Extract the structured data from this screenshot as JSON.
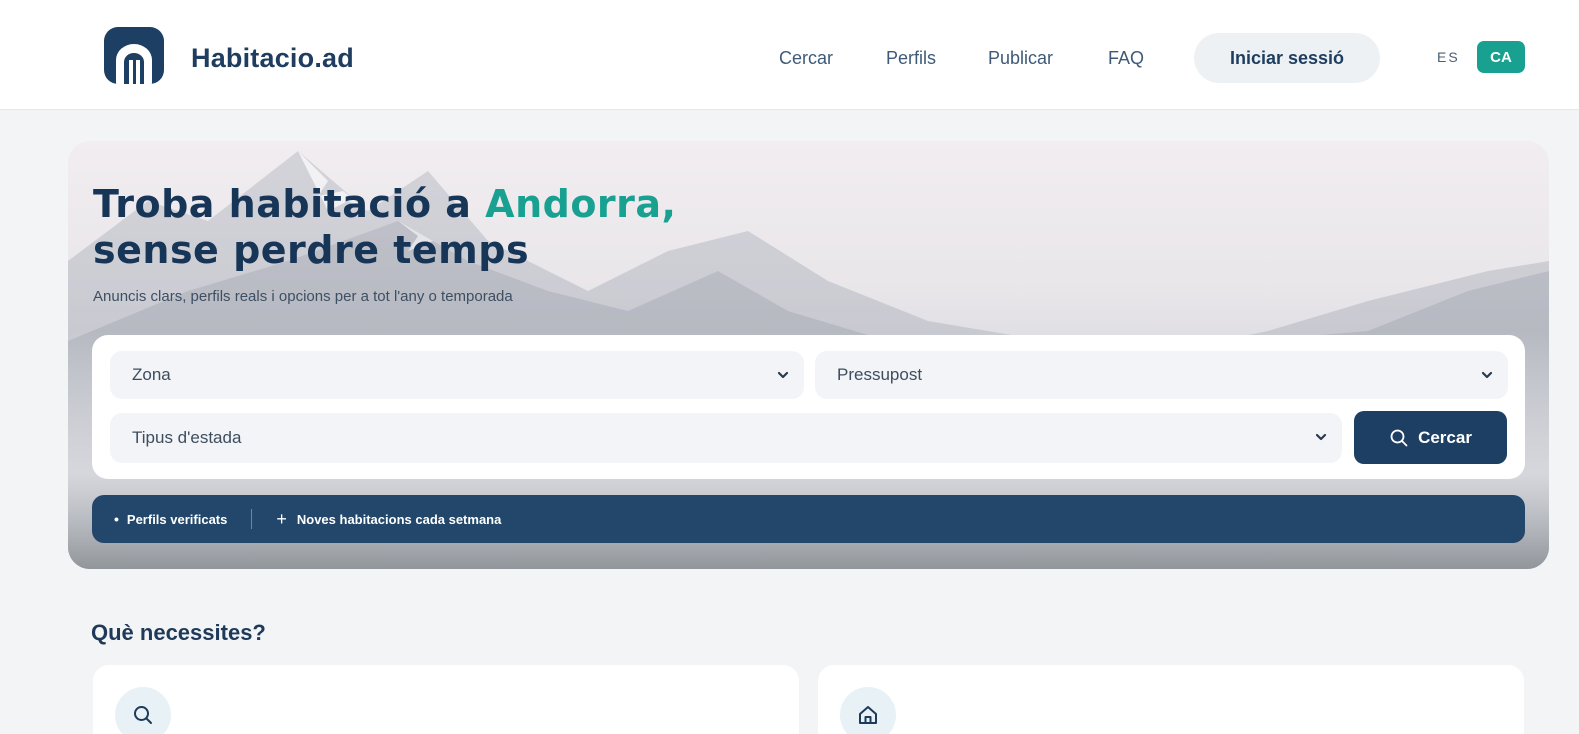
{
  "brand": {
    "name": "Habitacio.ad",
    "logo_icon": "door-arch-icon",
    "logo_color": "#1d3f64"
  },
  "nav": {
    "links": [
      "Cercar",
      "Perfils",
      "Publicar",
      "FAQ"
    ],
    "login_label": "Iniciar sessió",
    "lang_es": "ES",
    "lang_ca": "CA",
    "active_lang": "CA"
  },
  "hero": {
    "title_part1": "Troba habitació a ",
    "title_accent": "Andorra,",
    "title_line2": "sense perdre temps",
    "subtitle": "Anuncis clars, perfils reals i opcions per a tot l'any o temporada",
    "accent_color": "#18a191"
  },
  "search": {
    "zona": "Zona",
    "pressupost": "Pressupost",
    "tipus": "Tipus d'estada",
    "button_label": "Cercar"
  },
  "badges": {
    "verified": "Perfils verificats",
    "new_rooms": "Noves habitacions cada setmana"
  },
  "section": {
    "title": "Què necessites?",
    "card_icons": [
      "search-icon",
      "home-icon"
    ]
  }
}
